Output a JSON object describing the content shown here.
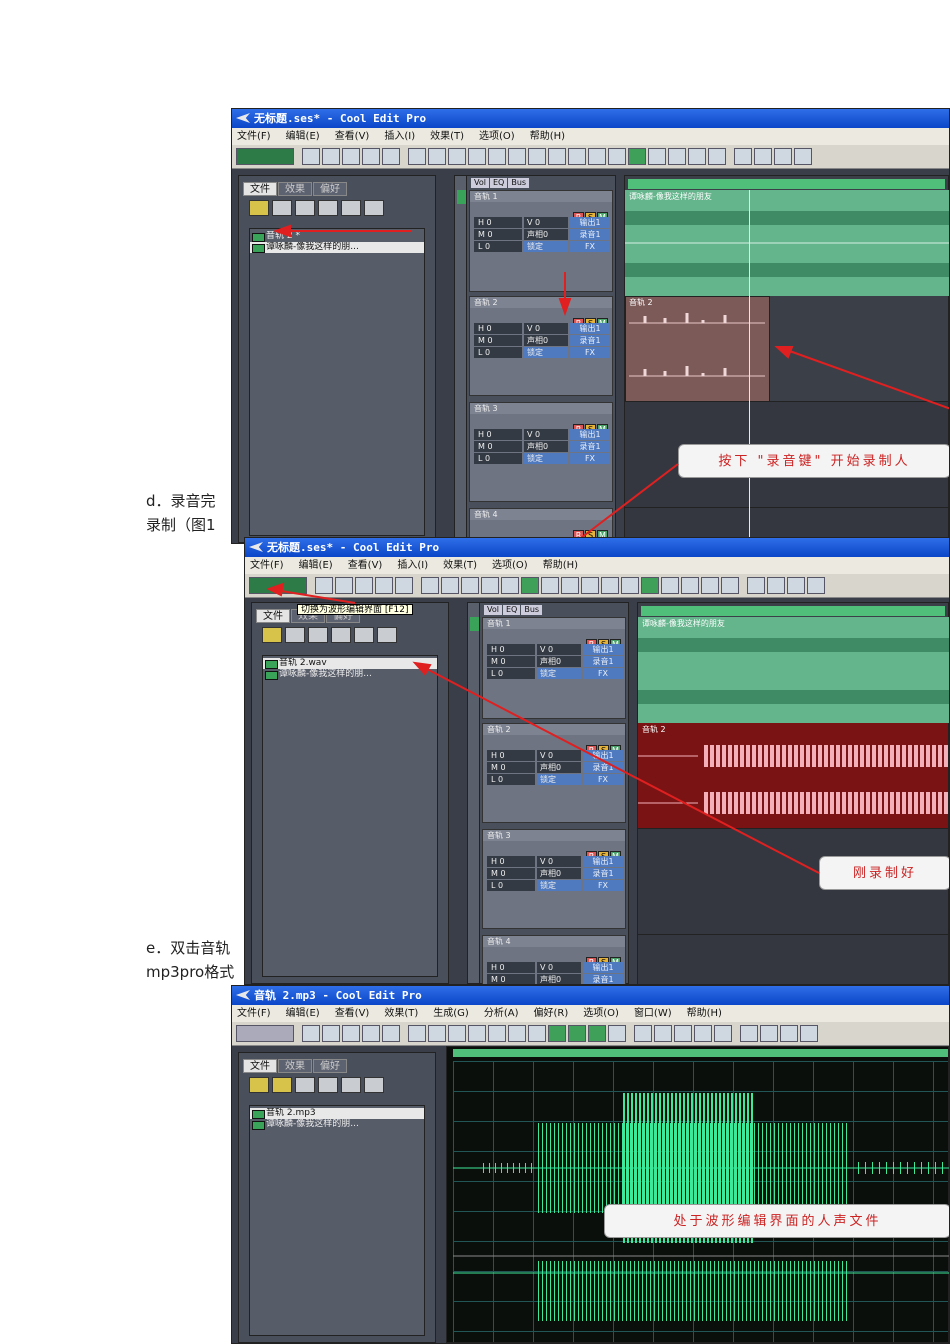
{
  "notes": {
    "d_line1": "d．录音完",
    "d_line2": "录制（图1",
    "e_line1": "e．双击音轨",
    "e_line2": "mp3pro格式"
  },
  "menu_multitrack": [
    "文件(F)",
    "编辑(E)",
    "查看(V)",
    "插入(I)",
    "效果(T)",
    "选项(O)",
    "帮助(H)"
  ],
  "menu_wave": [
    "文件(F)",
    "编辑(E)",
    "查看(V)",
    "效果(T)",
    "生成(G)",
    "分析(A)",
    "偏好(R)",
    "选项(O)",
    "窗口(W)",
    "帮助(H)"
  ],
  "tabs": [
    "文件",
    "效果",
    "偏好"
  ],
  "track_tabs": [
    "Vol",
    "EQ",
    "Bus"
  ],
  "rsm": [
    "R",
    "S",
    "M"
  ],
  "track_controls": {
    "row1": [
      "H 0",
      "V 0",
      "输出1"
    ],
    "row2": [
      "M 0",
      "声相0",
      "录音1"
    ],
    "row3": [
      "L 0",
      "锁定",
      "FX"
    ]
  },
  "window1": {
    "title": "无标题.ses* - Cool Edit Pro",
    "files": [
      "音轨 2 *",
      "谭咏麟-像我这样的朋..."
    ],
    "tracks": [
      "音轨 1",
      "音轨 2",
      "音轨 3",
      "音轨 4"
    ],
    "lane1_clip": "谭咏麟-像我这样的朋友",
    "lane2_clip": "音轨 2",
    "callout": "按下 \"录音键\" 开始录制人"
  },
  "window2": {
    "title": "无标题.ses* - Cool Edit Pro",
    "tooltip": "切换为波形编辑界面 [F12]",
    "files": [
      "音轨 2.wav",
      "谭咏麟-像我这样的朋..."
    ],
    "tracks": [
      "音轨 1",
      "音轨 2",
      "音轨 3",
      "音轨 4"
    ],
    "lane1_clip": "谭咏麟-像我这样的朋友",
    "lane2_clip": "音轨 2",
    "callout": "刚录制好"
  },
  "window3": {
    "title": "音轨 2.mp3 - Cool Edit Pro",
    "files": [
      "音轨 2.mp3",
      "谭咏麟-像我这样的朋..."
    ],
    "callout": "处于波形编辑界面的人声文件"
  },
  "colors": {
    "titlebar": "#0a46c8",
    "green_wave": "#6fc39a",
    "red_clip": "#7a1414",
    "pink_wave": "#f3b0b8",
    "bright_wave": "#3ee89a",
    "arrow": "#e02020"
  }
}
